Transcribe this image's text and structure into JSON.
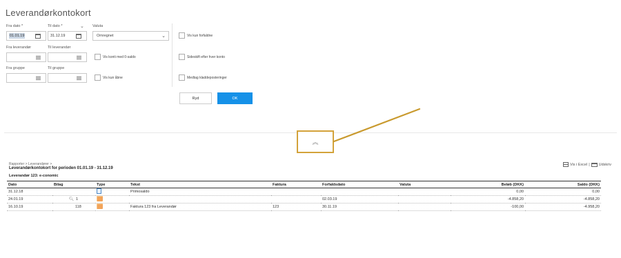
{
  "page": {
    "title": "Leverandørkontokort"
  },
  "filters": {
    "fra_dato": {
      "label": "Fra dato *",
      "value": "01.01.19"
    },
    "til_dato": {
      "label": "Til dato *",
      "value": "31.12.19"
    },
    "valuta": {
      "label": "Valuta",
      "value": "Omregnet"
    },
    "fra_leverandor": {
      "label": "Fra leverandør",
      "value": ""
    },
    "til_leverandor": {
      "label": "Til leverandør",
      "value": ""
    },
    "fra_gruppe": {
      "label": "Fra gruppe",
      "value": ""
    },
    "til_gruppe": {
      "label": "Til gruppe",
      "value": ""
    }
  },
  "checkboxes": {
    "vis_konti_med_0_saldo": "Vis konti med 0-saldo",
    "vis_kun_abne": "Vis kun åbne",
    "vis_kun_forfaldne": "Vis kun forfaldne",
    "sideskift": "Sideskift efter hver konto",
    "medtag_kladde": "Medtag kladdeposteringer"
  },
  "buttons": {
    "ryd": "Ryd",
    "ok": "OK"
  },
  "collapse": {
    "icon": "double-chevron-up"
  },
  "report": {
    "breadcrumb": "Rapporter > Leverandører >",
    "title": "Leverandørkontokort for perioden 01.01.19 - 31.12.19",
    "group": "Leverandør 123: e-conomic",
    "links": {
      "excel": "Vis i Excel",
      "separator": "|",
      "print": "Udskriv"
    },
    "columns": [
      "Dato",
      "Bilag",
      "Type",
      "Tekst",
      "Faktura",
      "Forfaldsdato",
      "Valuta",
      "Beløb (DKK)",
      "Saldo (DKK)"
    ],
    "rows": [
      {
        "dato": "31.12.18",
        "bilag": "",
        "type": "primo",
        "tekst": "Primosaldo",
        "faktura": "",
        "forfald": "",
        "valuta": "",
        "belob": "0,00",
        "saldo": "0,00"
      },
      {
        "dato": "24.01.19",
        "bilag": "1",
        "type": "invoice",
        "tekst": "",
        "faktura": "",
        "forfald": "02.03.19",
        "valuta": "",
        "belob": "-4.858,20",
        "saldo": "-4.858,20"
      },
      {
        "dato": "16.10.19",
        "bilag": "118",
        "type": "invoice",
        "tekst": "Faktura 123 fra Leverandør",
        "faktura": "123",
        "forfald": "30.11.19",
        "valuta": "",
        "belob": "-100,00",
        "saldo": "-4.958,20"
      }
    ]
  },
  "colors": {
    "accent": "#1591e8",
    "highlight": "#d3a23a"
  }
}
